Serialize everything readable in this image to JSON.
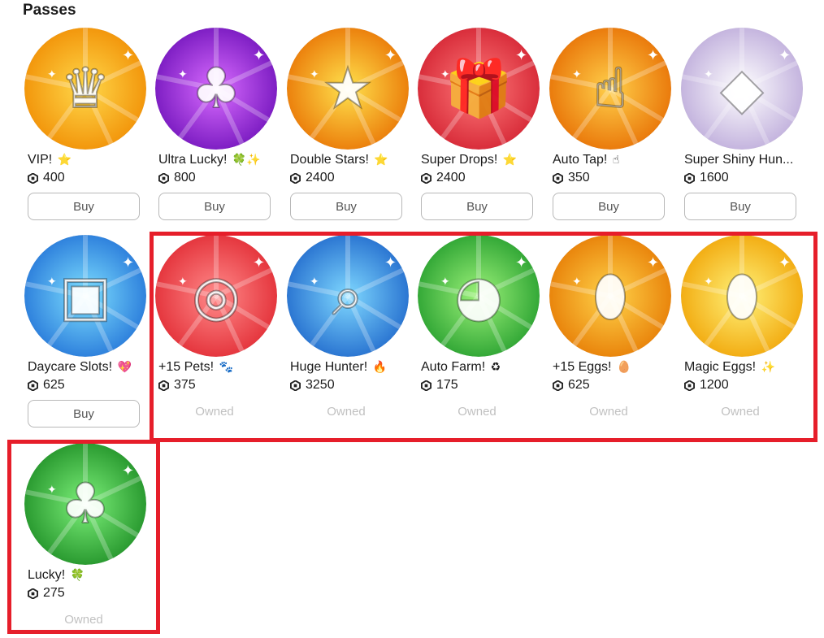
{
  "section_title": "Passes",
  "passes": [
    {
      "name": "VIP!",
      "emoji": "⭐",
      "price": "400",
      "action": "Buy",
      "icon": "crown-icon",
      "colors": [
        "#ffd84a",
        "#f08a00"
      ]
    },
    {
      "name": "Ultra Lucky!",
      "emoji": "🍀✨",
      "price": "800",
      "action": "Buy",
      "icon": "purple-clover-icon",
      "colors": [
        "#d96cff",
        "#6c0fb8"
      ]
    },
    {
      "name": "Double Stars!",
      "emoji": "⭐",
      "price": "2400",
      "action": "Buy",
      "icon": "stars-icon",
      "colors": [
        "#ffe14d",
        "#e86e00"
      ]
    },
    {
      "name": "Super Drops!",
      "emoji": "⭐",
      "price": "2400",
      "action": "Buy",
      "icon": "gift-icon",
      "colors": [
        "#ff7b7b",
        "#d11e2e"
      ]
    },
    {
      "name": "Auto Tap!",
      "emoji": "☝",
      "price": "350",
      "action": "Buy",
      "icon": "tap-hand-icon",
      "colors": [
        "#ffcf4a",
        "#e66a00"
      ]
    },
    {
      "name": "Super Shiny Hun...",
      "emoji": "",
      "price": "1600",
      "action": "Buy",
      "icon": "shiny-dice-icon",
      "colors": [
        "#ffffff",
        "#b9a6d8"
      ]
    },
    {
      "name": "Daycare Slots!",
      "emoji": "💖",
      "price": "625",
      "action": "Buy",
      "icon": "daycare-blocks-icon",
      "colors": [
        "#7fe0ff",
        "#1f6fd6"
      ]
    },
    {
      "name": "+15 Pets!",
      "emoji": "🐾",
      "price": "375",
      "action": "Owned",
      "icon": "pet-collar-icon",
      "colors": [
        "#ff8a8a",
        "#e0262f"
      ]
    },
    {
      "name": "Huge Hunter!",
      "emoji": "🔥",
      "price": "3250",
      "action": "Owned",
      "icon": "magnifier-icon",
      "colors": [
        "#7fd8ff",
        "#1b63c9"
      ]
    },
    {
      "name": "Auto Farm!",
      "emoji": "♻",
      "price": "175",
      "action": "Owned",
      "icon": "cat-icon",
      "colors": [
        "#9df27a",
        "#1f9a2a"
      ]
    },
    {
      "name": "+15 Eggs!",
      "emoji": "🥚",
      "price": "625",
      "action": "Owned",
      "icon": "egg-icon",
      "colors": [
        "#ffd34a",
        "#e57600"
      ]
    },
    {
      "name": "Magic Eggs!",
      "emoji": "✨",
      "price": "1200",
      "action": "Owned",
      "icon": "rainbow-egg-icon",
      "colors": [
        "#fff27a",
        "#f0a000"
      ]
    },
    {
      "name": "Lucky!",
      "emoji": "🍀",
      "price": "275",
      "action": "Owned",
      "icon": "clover-icon",
      "colors": [
        "#7df07a",
        "#1a8a22"
      ]
    }
  ],
  "highlight_color": "#e61e2a"
}
